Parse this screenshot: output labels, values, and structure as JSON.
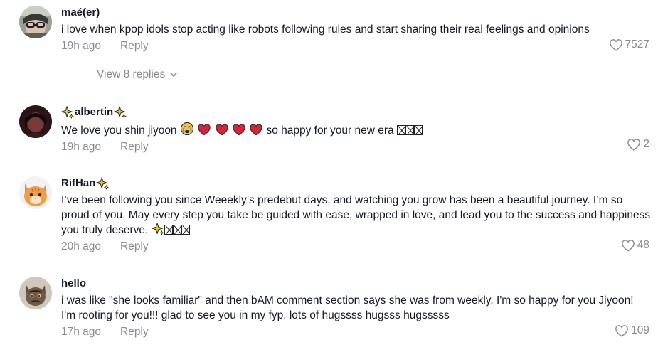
{
  "colors": {
    "text": "#161823",
    "muted": "#8a8b91",
    "heart_emoji": "#d8243a",
    "sparkle": "#f0c419"
  },
  "comments": [
    {
      "username": "maé(er)",
      "text": "i love when kpop idols stop acting like robots following rules and start sharing their real feelings and opinions",
      "time": "19h ago",
      "reply_label": "Reply",
      "likes": "7527",
      "avatar": "avatar-grey-glasses"
    },
    {
      "username": "albertin",
      "text_prefix": "We love you shin jiyoon",
      "text_suffix": "so happy for your new era",
      "time": "19h ago",
      "reply_label": "Reply",
      "likes": "2",
      "avatar": "avatar-dark-red",
      "emojis": [
        "crying-face-emoji",
        "heart-emoji",
        "heart-emoji",
        "heart-emoji",
        "heart-emoji"
      ]
    },
    {
      "username": "RifHan",
      "text": "I’ve been following you since Weeekly’s predebut days, and watching you grow has been a beautiful journey. I’m so proud of you. May every step you take be guided with ease, wrapped in love, and lead you to the success and happiness you truly deserve.",
      "time": "20h ago",
      "reply_label": "Reply",
      "likes": "48",
      "avatar": "avatar-orange-cat"
    },
    {
      "username": "hello",
      "text": "i was like \"she looks familiar\" and then bAM comment section says she was from weekly. I'm so happy for you Jiyoon! I'm rooting for you!!! glad to see you in my fyp. lots of hugssss hugsss hugsssss",
      "time": "17h ago",
      "reply_label": "Reply",
      "likes": "109",
      "avatar": "avatar-tabby-cat"
    }
  ],
  "view_replies_label": "View 8 replies"
}
